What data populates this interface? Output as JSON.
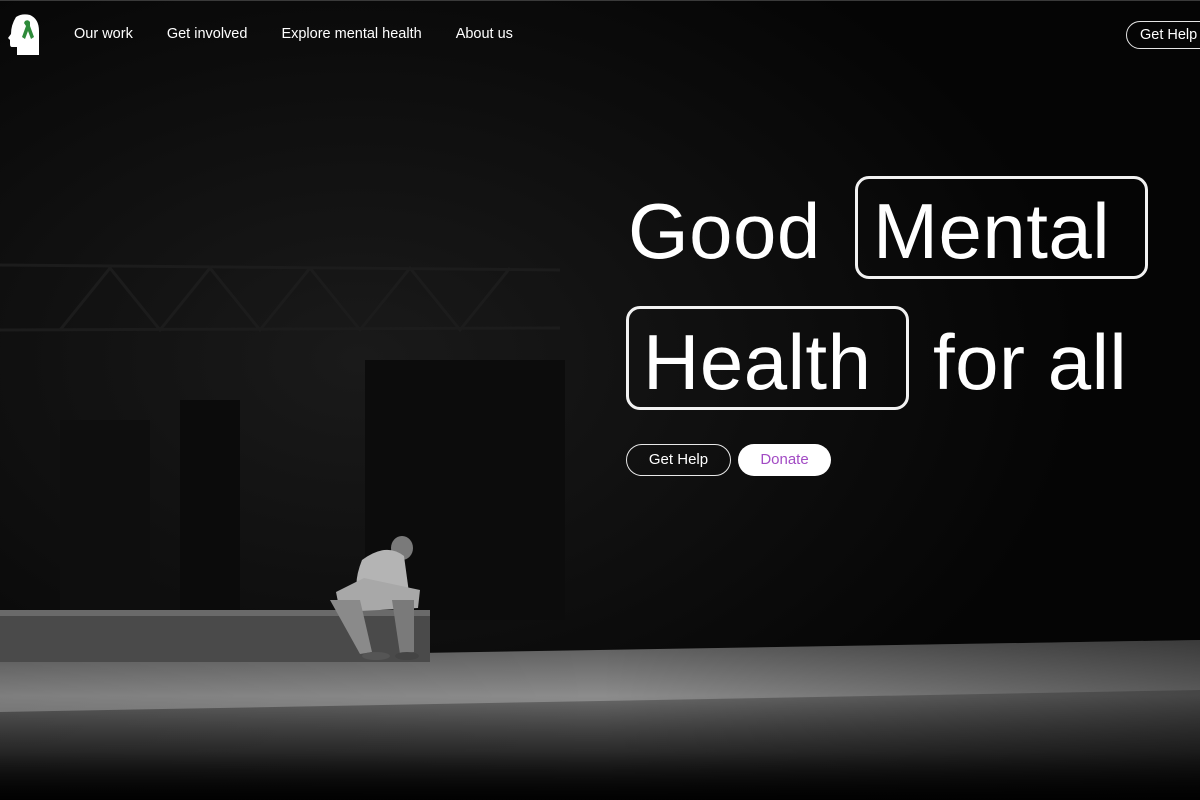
{
  "nav": {
    "logo": "head-ribbon-logo",
    "links": [
      {
        "label": "Our work"
      },
      {
        "label": "Get involved"
      },
      {
        "label": "Explore mental health"
      },
      {
        "label": "About us"
      }
    ],
    "help_button": "Get Help"
  },
  "hero": {
    "headline": {
      "word1": "Good",
      "word2": "Mental",
      "word3": "Health",
      "word4": "for all"
    },
    "cta_primary": "Get Help",
    "cta_secondary": "Donate",
    "image": "person-sitting-alone-on-bench"
  },
  "colors": {
    "background": "#000000",
    "text": "#ffffff",
    "donate_text": "#a24bc4",
    "ribbon": "#2e8b3a"
  }
}
